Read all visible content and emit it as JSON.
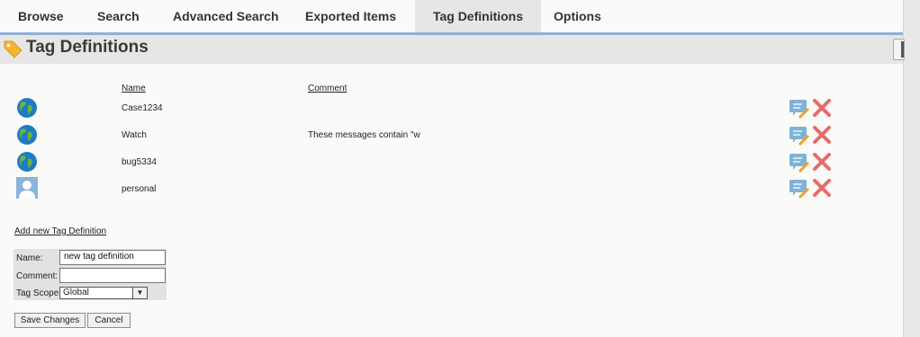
{
  "nav": {
    "tabs": [
      {
        "label": "Browse"
      },
      {
        "label": "Search"
      },
      {
        "label": "Advanced Search"
      },
      {
        "label": "Exported Items"
      },
      {
        "label": "Tag Definitions",
        "active": true
      },
      {
        "label": "Options"
      }
    ]
  },
  "page": {
    "title": "Tag Definitions"
  },
  "table": {
    "headers": {
      "name": "Name",
      "comment": "Comment"
    },
    "rows": [
      {
        "icon": "globe-icon",
        "name": "Case1234",
        "comment": ""
      },
      {
        "icon": "globe-icon",
        "name": "Watch",
        "comment": "These messages contain \"w"
      },
      {
        "icon": "globe-icon",
        "name": "bug5334",
        "comment": ""
      },
      {
        "icon": "user-icon",
        "name": "personal",
        "comment": ""
      }
    ]
  },
  "form": {
    "add_link": "Add new Tag Definition",
    "name_label": "Name:",
    "name_value": "new tag definition",
    "comment_label": "Comment:",
    "comment_value": "",
    "scope_label": "Tag Scope:",
    "scope_value": "Global",
    "save_label": "Save Changes",
    "cancel_label": "Cancel"
  },
  "colors": {
    "accent_line": "#8fb0d4",
    "delete": "#e86b6b",
    "edit": "#7fb3d6"
  }
}
